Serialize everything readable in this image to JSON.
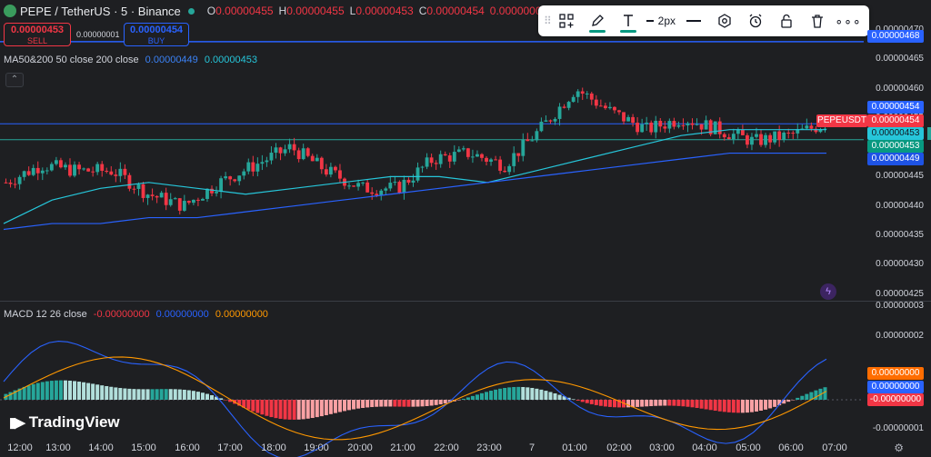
{
  "header": {
    "symbol": "PEPE / TetherUS · 5 · Binance",
    "o_label": "O",
    "o_value": "0.00000455",
    "h_label": "H",
    "h_value": "0.00000455",
    "l_label": "L",
    "l_value": "0.00000453",
    "c_label": "C",
    "c_value": "0.00000454",
    "change": "0.00000000 (0.00%)"
  },
  "trade": {
    "sell_price": "0.00000453",
    "sell_label": "SELL",
    "spread": "0.00000001",
    "buy_price": "0.00000454",
    "buy_label": "BUY"
  },
  "ma_legend": {
    "label": "MA50&200 50 close 200 close",
    "ma50": "0.00000449",
    "ma200": "0.00000453"
  },
  "toolbar": {
    "width_label": "2px"
  },
  "price_axis": [
    "0.00000470",
    "0.00000465",
    "0.00000460",
    "0.00000455",
    "0.00000450",
    "0.00000445",
    "0.00000440",
    "0.00000435",
    "0.00000430",
    "0.00000425"
  ],
  "price_tags": {
    "alert": "0.00000468",
    "last_blue": "0.00000454",
    "last_red": "0.00000454",
    "pair": "PEPEUSDT",
    "ma_cyan": "0.00000453",
    "ma_green": "0.00000453",
    "ma_blue": "0.00000449"
  },
  "macd_legend": {
    "label": "MACD 12 26 close",
    "macd": "-0.00000000",
    "signal": "0.00000000",
    "hist": "0.00000000"
  },
  "macd_axis": {
    "top": "0.00000003",
    "mid": "0.00000002",
    "low": "-0.00000001"
  },
  "macd_tags": {
    "orange": "0.00000000",
    "blue": "0.00000000",
    "red": "-0.00000000"
  },
  "time_axis": [
    "12:00",
    "13:00",
    "14:00",
    "15:00",
    "16:00",
    "17:00",
    "18:00",
    "19:00",
    "20:00",
    "21:00",
    "22:00",
    "23:00",
    "7",
    "01:00",
    "02:00",
    "03:00",
    "04:00",
    "05:00",
    "06:00",
    "07:00"
  ],
  "brand": "TradingView",
  "colors": {
    "up": "#26a69a",
    "down": "#f23645",
    "ma50": "#26c6da",
    "ma200": "#2962ff",
    "macd": "#2962ff",
    "signal": "#ff9800",
    "accent": "#089981"
  },
  "chart_data": {
    "type": "candlestick",
    "title": "PEPE / TetherUS · 5 · Binance",
    "x": [
      "12:00",
      "13:00",
      "14:00",
      "15:00",
      "16:00",
      "17:00",
      "18:00",
      "19:00",
      "20:00",
      "21:00",
      "22:00",
      "23:00",
      "7",
      "01:00",
      "02:00",
      "03:00",
      "04:00",
      "05:00",
      "06:00",
      "07:00"
    ],
    "ylim": [
      4.24e-06,
      4.72e-06
    ],
    "close_path": [
      4.44e-06,
      4.47e-06,
      4.46e-06,
      4.46e-06,
      4.42e-06,
      4.4e-06,
      4.44e-06,
      4.47e-06,
      4.5e-06,
      4.46e-06,
      4.43e-06,
      4.43e-06,
      4.48e-06,
      4.49e-06,
      4.47e-06,
      4.53e-06,
      4.6e-06,
      4.56e-06,
      4.53e-06,
      4.55e-06,
      4.53e-06,
      4.51e-06,
      4.52e-06,
      4.54e-06
    ],
    "series": [
      {
        "name": "MA50",
        "values": [
          4.37e-06,
          4.41e-06,
          4.43e-06,
          4.44e-06,
          4.43e-06,
          4.42e-06,
          4.43e-06,
          4.44e-06,
          4.45e-06,
          4.45e-06,
          4.44e-06,
          4.46e-06,
          4.48e-06,
          4.5e-06,
          4.52e-06,
          4.53e-06,
          4.53e-06,
          4.53e-06
        ]
      },
      {
        "name": "MA200",
        "values": [
          4.36e-06,
          4.37e-06,
          4.37e-06,
          4.38e-06,
          4.38e-06,
          4.39e-06,
          4.4e-06,
          4.41e-06,
          4.42e-06,
          4.43e-06,
          4.44e-06,
          4.45e-06,
          4.46e-06,
          4.47e-06,
          4.48e-06,
          4.49e-06,
          4.49e-06,
          4.49e-06
        ]
      }
    ],
    "horizontal_lines": [
      4.68e-06,
      4.54e-06,
      4.53e-06
    ]
  }
}
